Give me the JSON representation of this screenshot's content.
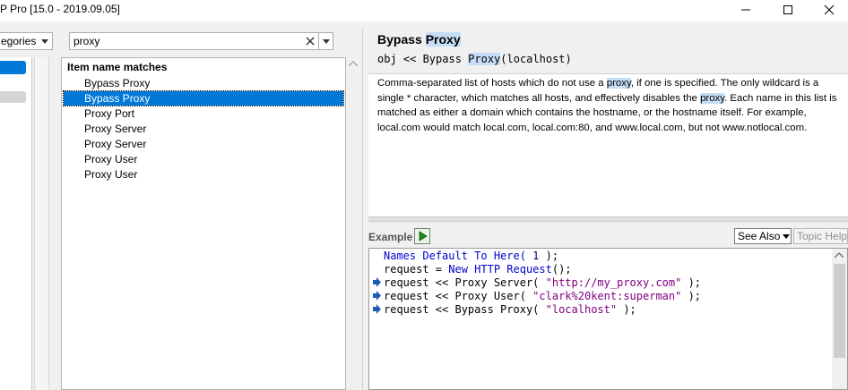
{
  "window": {
    "title": "P Pro [15.0  - 2019.09.05]"
  },
  "toolbar": {
    "category_select": "egories",
    "search_value": "proxy"
  },
  "results": {
    "header": "Item name matches",
    "items": [
      {
        "label": "Bypass Proxy",
        "selected": false
      },
      {
        "label": "Bypass Proxy",
        "selected": true
      },
      {
        "label": "Proxy Port",
        "selected": false
      },
      {
        "label": "Proxy Server",
        "selected": false
      },
      {
        "label": "Proxy Server",
        "selected": false
      },
      {
        "label": "Proxy User",
        "selected": false
      },
      {
        "label": "Proxy User",
        "selected": false
      }
    ]
  },
  "doc": {
    "title_part1": "Bypass ",
    "title_part2": "Proxy",
    "sig_part1": "obj << Bypass ",
    "sig_part2": "Proxy",
    "sig_part3": "(localhost)",
    "desc_1": "Comma-separated list of hosts which do not use a ",
    "desc_proxy1": "proxy",
    "desc_2": ", if one is specified. The only wildcard is a single * character, which matches all hosts, and effectively disables the ",
    "desc_proxy2": "proxy",
    "desc_3": ". Each name in this list is matched as either a domain which contains the hostname, or the hostname itself. For example, local.com would match local.com, local.com:80, and www.local.com, but not www.notlocal.com."
  },
  "example": {
    "label": "Example",
    "see_also": "See Also",
    "topic_help": "Topic Help",
    "code": {
      "l1a": "Names Default To Here( ",
      "l1n": "1",
      "l1b": " );",
      "l2a": "request = ",
      "l2k": "New HTTP Request",
      "l2b": "();",
      "l3a": "request << Proxy Server( ",
      "l3s": "\"http://my_proxy.com\"",
      "l3b": " );",
      "l4a": "request << Proxy User( ",
      "l4s": "\"clark%20kent:superman\"",
      "l4b": " );",
      "l5a": "request << Bypass Proxy( ",
      "l5s": "\"localhost\"",
      "l5b": " );"
    }
  },
  "colors": {
    "selection": "#0078d7",
    "highlight": "#c5ddf5",
    "keyword": "#0000cc",
    "string": "#800080",
    "marker": "#1e5bb8"
  }
}
